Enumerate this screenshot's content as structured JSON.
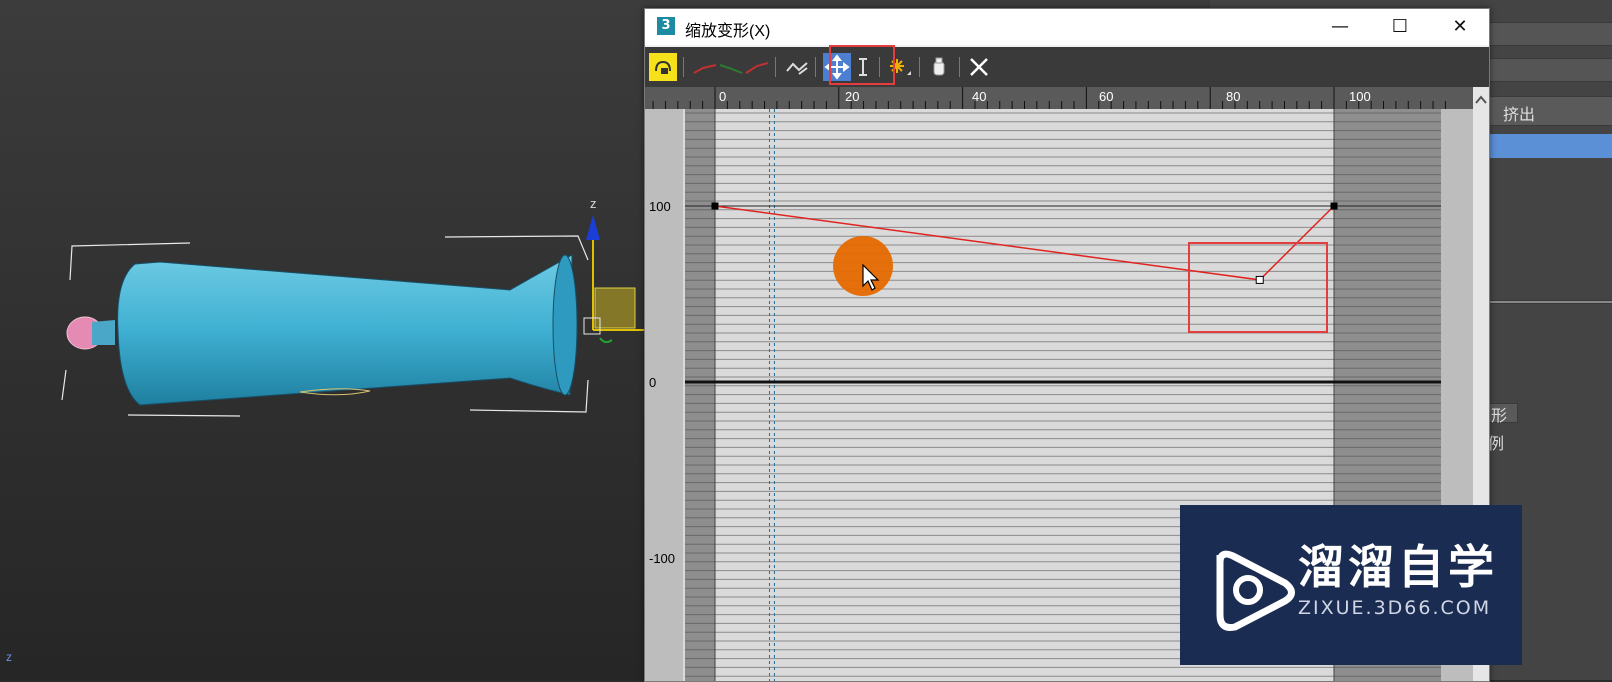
{
  "viewport": {
    "axis_z_label": "z",
    "corner_axis_label": "z"
  },
  "command_panel": {
    "extrude_label": "挤出",
    "shape_label": "图形",
    "instance_label": "实例"
  },
  "dialog": {
    "icon_text": "3",
    "title": "缩放变形(X)",
    "window_controls": {
      "minimize": "—",
      "maximize": "☐",
      "close": "✕"
    },
    "toolbar": {
      "tools": [
        "lock-aspect",
        "make-symmetrical",
        "display-x-axis",
        "display-y-axis",
        "display-xy-axes",
        "swap-deform-curves",
        "move-control-point",
        "scale-control-point",
        "insert-corner-point",
        "delete-control-point",
        "reset-curve"
      ],
      "active_tool": "move-control-point"
    },
    "ruler": {
      "ticks": [
        "0",
        "20",
        "40",
        "60",
        "80",
        "100"
      ]
    },
    "y_axis": {
      "labels": [
        "100",
        "0",
        "-100"
      ]
    }
  },
  "chart_data": {
    "type": "line",
    "title": "",
    "xlabel": "",
    "ylabel": "",
    "xlim": [
      0,
      100
    ],
    "x_ticks": [
      0,
      20,
      40,
      60,
      80,
      100
    ],
    "y_ticks": [
      100,
      0,
      -100
    ],
    "series": [
      {
        "points": [
          [
            0,
            100
          ],
          [
            88,
            58
          ],
          [
            100,
            100
          ]
        ]
      }
    ],
    "colors": {
      "curve": "#e0241f",
      "highlight": "#e43d3d"
    }
  },
  "cursor": {
    "color": "#e66a00"
  },
  "watermark": {
    "brand": "溜溜自学",
    "url": "ZIXUE.3D66.COM",
    "bg": "#1b2c52"
  }
}
